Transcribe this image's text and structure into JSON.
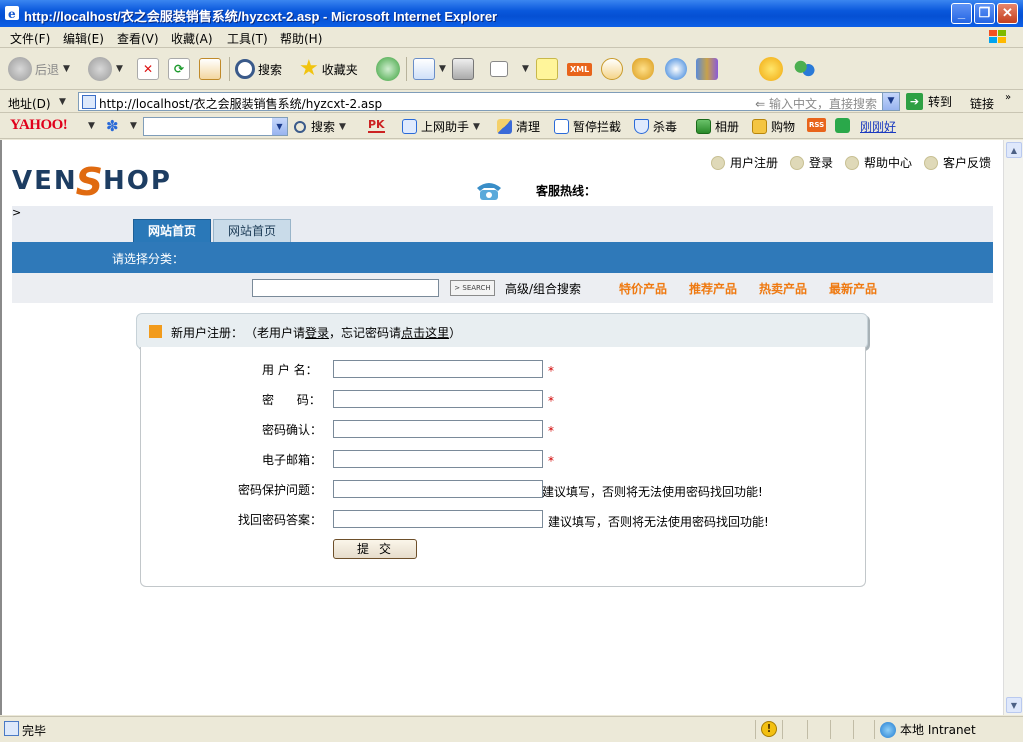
{
  "window": {
    "title": "http://localhost/衣之会服装销售系统/hyzcxt-2.asp - Microsoft Internet Explorer",
    "minimize": "_",
    "maximize": "❐",
    "close": "✕"
  },
  "menubar": {
    "items": [
      "文件(F)",
      "编辑(E)",
      "查看(V)",
      "收藏(A)",
      "工具(T)",
      "帮助(H)"
    ]
  },
  "toolbar": {
    "back_label": "后退",
    "search_label": "搜索",
    "favorites_label": "收藏夹"
  },
  "addressbar": {
    "label": "地址(D)",
    "url": "http://localhost/衣之会服装销售系统/hyzcxt-2.asp",
    "hint": "输入中文，直接搜索",
    "go_label": "转到",
    "links_label": "链接"
  },
  "yahoobar": {
    "logo": "YAHOO!",
    "search_label": "搜索",
    "pk": "PK",
    "web_assistant": "上网助手",
    "clean": "清理",
    "popup_block": "暂停拦截",
    "antivirus": "杀毒",
    "album": "相册",
    "shopping": "购物",
    "rss": "RSS",
    "just_now": "刚刚好"
  },
  "site": {
    "logo_left": "VEN",
    "logo_s": "S",
    "logo_right": "HOP",
    "toplinks": [
      "用户注册",
      "登录",
      "帮助中心",
      "客户反馈"
    ],
    "hotline_label": "客服热线：",
    "chevron": ">",
    "tabs": [
      "网站首页",
      "网站首页"
    ],
    "category_label": "请选择分类：",
    "search_button": "> SEARCH",
    "advanced_search": "高级/组合搜索",
    "product_links": [
      "特价产品",
      "推荐产品",
      "热卖产品",
      "最新产品"
    ]
  },
  "registration": {
    "header_prefix": "新用户注册：",
    "header_paren_open": "（老用户请",
    "header_login": "登录",
    "header_mid": "，忘记密码请",
    "header_click": "点击这里",
    "header_paren_close": "）",
    "fields": [
      {
        "label": "用 户 名：",
        "value": "",
        "required": "*"
      },
      {
        "label": "密      码：",
        "value": "",
        "required": "*"
      },
      {
        "label": "密码确认：",
        "value": "",
        "required": "*"
      },
      {
        "label": "电子邮箱：",
        "value": "",
        "required": "*"
      },
      {
        "label": "密码保护问题：",
        "value": "",
        "note": "建议填写，否则将无法使用密码找回功能!"
      },
      {
        "label": "找回密码答案：",
        "value": "",
        "note": "建议填写，否则将无法使用密码找回功能!"
      }
    ],
    "submit_label": "提交"
  },
  "statusbar": {
    "status": "完毕",
    "zone": "本地 Intranet"
  },
  "colors": {
    "titlebar_blue": "#0550d3",
    "nav_blue": "#2f79b9",
    "accent_orange": "#ef7a12",
    "required_red": "#d10000"
  }
}
